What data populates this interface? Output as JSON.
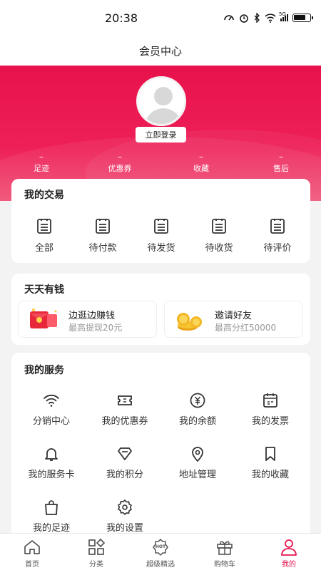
{
  "status_bar": {
    "time": "20:38",
    "network": "5G"
  },
  "header": {
    "title": "会员中心"
  },
  "profile": {
    "login_label": "立即登录"
  },
  "stats": [
    {
      "value": "–",
      "label": "足迹"
    },
    {
      "value": "–",
      "label": "优惠券"
    },
    {
      "value": "–",
      "label": "收藏"
    },
    {
      "value": "–",
      "label": "售后"
    }
  ],
  "trade": {
    "title": "我的交易",
    "items": [
      {
        "label": "全部",
        "icon": "list-icon"
      },
      {
        "label": "待付款",
        "icon": "list-icon"
      },
      {
        "label": "待发货",
        "icon": "list-icon"
      },
      {
        "label": "待收货",
        "icon": "list-icon"
      },
      {
        "label": "待评价",
        "icon": "list-icon"
      }
    ]
  },
  "earn": {
    "title": "天天有钱",
    "cards": [
      {
        "title": "边逛边赚钱",
        "subtitle": "最高提现20元",
        "icon": "red-envelope-icon"
      },
      {
        "title": "邀请好友",
        "subtitle": "最高分红50000",
        "icon": "gold-coins-icon"
      }
    ]
  },
  "services": {
    "title": "我的服务",
    "items": [
      {
        "label": "分销中心",
        "icon": "wifi-icon"
      },
      {
        "label": "我的优惠券",
        "icon": "coupon-icon"
      },
      {
        "label": "我的余额",
        "icon": "yuan-icon"
      },
      {
        "label": "我的发票",
        "icon": "invoice-icon"
      },
      {
        "label": "我的服务卡",
        "icon": "bell-icon"
      },
      {
        "label": "我的积分",
        "icon": "diamond-icon"
      },
      {
        "label": "地址管理",
        "icon": "location-icon"
      },
      {
        "label": "我的收藏",
        "icon": "bookmark-icon"
      },
      {
        "label": "我的足迹",
        "icon": "bag-icon"
      },
      {
        "label": "我的设置",
        "icon": "settings-icon"
      }
    ]
  },
  "tabbar": [
    {
      "label": "首页",
      "icon": "home-icon"
    },
    {
      "label": "分类",
      "icon": "category-icon"
    },
    {
      "label": "超级精选",
      "icon": "hot-icon",
      "badge": "HOT"
    },
    {
      "label": "购物车",
      "icon": "gift-icon"
    },
    {
      "label": "我的",
      "icon": "user-icon",
      "active": true
    }
  ],
  "colors": {
    "accent": "#e8124c",
    "background": "#f3f3f3"
  }
}
